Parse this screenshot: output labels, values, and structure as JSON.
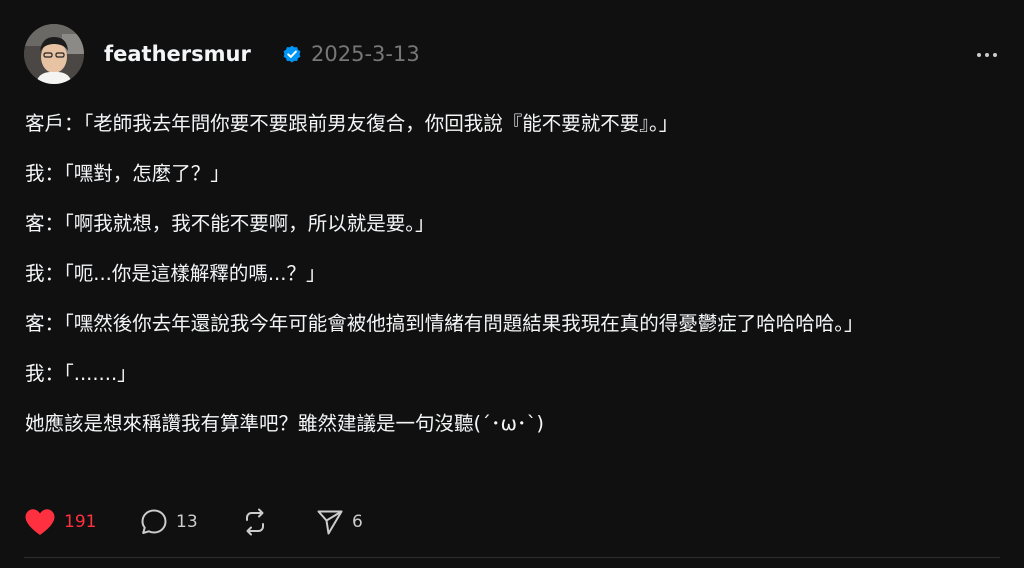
{
  "post": {
    "username": "feathersmur",
    "timestamp": "2025-3-13",
    "verified": true,
    "paragraphs": [
      "客戶：「老師我去年問你要不要跟前男友復合，你回我說『能不要就不要』。」",
      "我：「嘿對，怎麼了？」",
      "客：「啊我就想，我不能不要啊，所以就是要。」",
      "我：「呃...你是這樣解釋的嗎...？」",
      "客：「嘿然後你去年還說我今年可能會被他搞到情緒有問題結果我現在真的得憂鬱症了哈哈哈哈。」",
      "我：「.......」",
      "她應該是想來稱讚我有算準吧？雖然建議是一句沒聽(´･ω･`)"
    ]
  },
  "actions": {
    "like_count": "191",
    "reply_count": "13",
    "share_count": "6",
    "icons": [
      "heart-icon",
      "comment-icon",
      "repost-icon",
      "send-icon"
    ]
  },
  "colors": {
    "background": "#101010",
    "text": "#f3f5f7",
    "muted": "#777777",
    "like": "#ff3040",
    "verified": "#0095f6"
  }
}
